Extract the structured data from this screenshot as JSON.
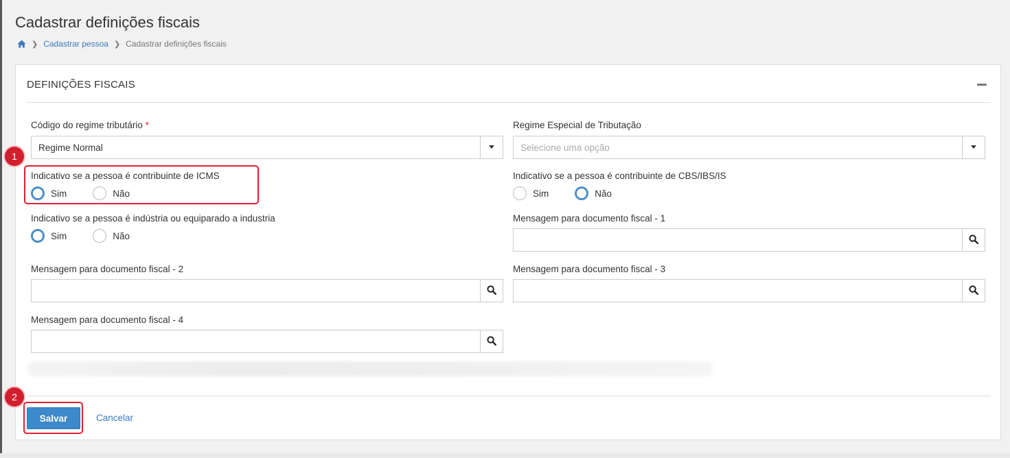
{
  "page": {
    "title": "Cadastrar definições fiscais",
    "breadcrumb": {
      "home_icon": "home-icon",
      "items": [
        "Cadastrar pessoa",
        "Cadastrar definições fiscais"
      ]
    }
  },
  "panel": {
    "title": "DEFINIÇÕES FISCAIS",
    "collapse_icon": "minus-icon"
  },
  "form": {
    "regime_tributario": {
      "label": "Código do regime tributário",
      "required_mark": "*",
      "value": "Regime Normal"
    },
    "regime_especial": {
      "label": "Regime Especial de Tributação",
      "placeholder": "Selecione uma opção"
    },
    "contribuinte_icms": {
      "label": "Indicativo se a pessoa é contribuinte de ICMS",
      "options": [
        "Sim",
        "Não"
      ],
      "selected": "Sim"
    },
    "contribuinte_cbs": {
      "label": "Indicativo se a pessoa é contribuinte de CBS/IBS/IS",
      "options": [
        "Sim",
        "Não"
      ],
      "selected": "Não"
    },
    "industria": {
      "label": "Indicativo se a pessoa é indústria ou equiparado a industria",
      "options": [
        "Sim",
        "Não"
      ],
      "selected": "Sim"
    },
    "mensagem_1": {
      "label": "Mensagem para documento fiscal - 1",
      "value": ""
    },
    "mensagem_2": {
      "label": "Mensagem para documento fiscal - 2",
      "value": ""
    },
    "mensagem_3": {
      "label": "Mensagem para documento fiscal - 3",
      "value": ""
    },
    "mensagem_4": {
      "label": "Mensagem para documento fiscal - 4",
      "value": ""
    }
  },
  "actions": {
    "save_label": "Salvar",
    "cancel_label": "Cancelar"
  },
  "annotations": {
    "marker_1": "1",
    "marker_2": "2"
  },
  "colors": {
    "accent": "#3d89c9",
    "highlight": "#e02030"
  }
}
